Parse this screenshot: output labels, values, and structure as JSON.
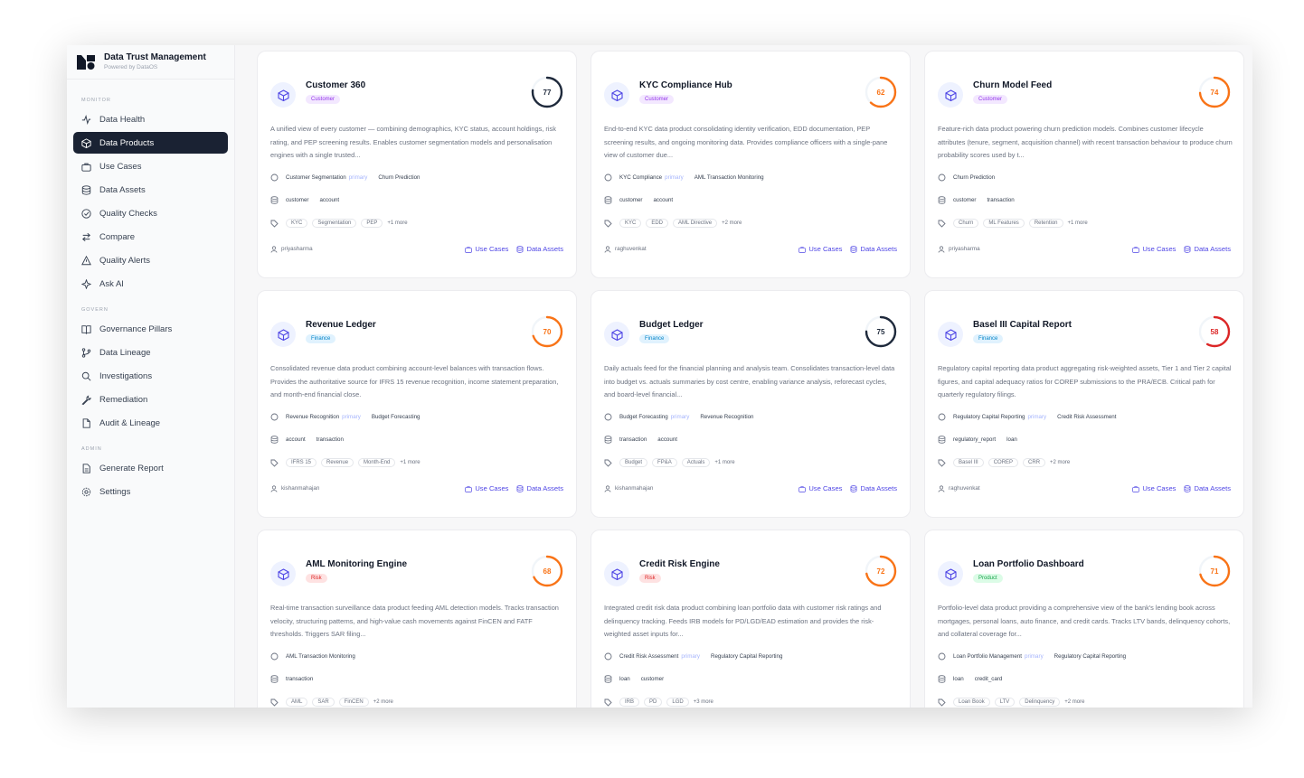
{
  "app": {
    "title": "Data Trust Management",
    "subtitle": "Powered by DataOS"
  },
  "nav": {
    "sections": [
      {
        "label": "MONITOR",
        "items": [
          {
            "label": "Data Health",
            "icon": "activity-icon",
            "active": false
          },
          {
            "label": "Data Products",
            "icon": "cube-icon",
            "active": true
          },
          {
            "label": "Use Cases",
            "icon": "briefcase-icon",
            "active": false
          },
          {
            "label": "Data Assets",
            "icon": "database-icon",
            "active": false
          },
          {
            "label": "Quality Checks",
            "icon": "check-circle-icon",
            "active": false
          },
          {
            "label": "Compare",
            "icon": "compare-icon",
            "active": false
          },
          {
            "label": "Quality Alerts",
            "icon": "alert-icon",
            "active": false
          },
          {
            "label": "Ask AI",
            "icon": "sparkle-icon",
            "active": false
          }
        ]
      },
      {
        "label": "GOVERN",
        "items": [
          {
            "label": "Governance Pillars",
            "icon": "book-icon",
            "active": false
          },
          {
            "label": "Data Lineage",
            "icon": "lineage-icon",
            "active": false
          },
          {
            "label": "Investigations",
            "icon": "search-icon",
            "active": false
          },
          {
            "label": "Remediation",
            "icon": "wrench-icon",
            "active": false
          },
          {
            "label": "Audit & Lineage",
            "icon": "file-icon",
            "active": false
          }
        ]
      },
      {
        "label": "ADMIN",
        "items": [
          {
            "label": "Generate Report",
            "icon": "report-icon",
            "active": false
          },
          {
            "label": "Settings",
            "icon": "gear-icon",
            "active": false
          }
        ]
      }
    ]
  },
  "colors": {
    "accent": "#4f46e5",
    "active_nav_bg": "#1a2233"
  },
  "cards": [
    {
      "title": "Customer 360",
      "badge": "Customer",
      "badge_type": "customer",
      "score": 77,
      "score_color": "#1e293b",
      "description": "A unified view of every customer — combining demographics, KYC status, account holdings, risk rating, and PEP screening results. Enables customer segmentation models and personalisation engines with a single trusted...",
      "use_cases": [
        "Customer Segmentation",
        "Churn Prediction"
      ],
      "primary_label": "primary",
      "assets": [
        "customer",
        "account"
      ],
      "tags": [
        "KYC",
        "Segmentation",
        "PEP"
      ],
      "more": "+1 more",
      "owner": "priyasharma",
      "link_use_cases": "Use Cases",
      "link_data_assets": "Data Assets"
    },
    {
      "title": "KYC Compliance Hub",
      "badge": "Customer",
      "badge_type": "customer",
      "score": 62,
      "score_color": "#f97316",
      "description": "End-to-end KYC data product consolidating identity verification, EDD documentation, PEP screening results, and ongoing monitoring data. Provides compliance officers with a single-pane view of customer due...",
      "use_cases": [
        "KYC Compliance",
        "AML Transaction Monitoring"
      ],
      "primary_label": "primary",
      "assets": [
        "customer",
        "account"
      ],
      "tags": [
        "KYC",
        "EDD",
        "AML Directive"
      ],
      "more": "+2 more",
      "owner": "raghuvenkat",
      "link_use_cases": "Use Cases",
      "link_data_assets": "Data Assets"
    },
    {
      "title": "Churn Model Feed",
      "badge": "Customer",
      "badge_type": "customer",
      "score": 74,
      "score_color": "#f97316",
      "description": "Feature-rich data product powering churn prediction models. Combines customer lifecycle attributes (tenure, segment, acquisition channel) with recent transaction behaviour to produce churn probability scores used by t...",
      "use_cases": [
        "Churn Prediction"
      ],
      "primary_label": "",
      "assets": [
        "customer",
        "transaction"
      ],
      "tags": [
        "Churn",
        "ML Features",
        "Retention"
      ],
      "more": "+1 more",
      "owner": "priyasharma",
      "link_use_cases": "Use Cases",
      "link_data_assets": "Data Assets"
    },
    {
      "title": "Revenue Ledger",
      "badge": "Finance",
      "badge_type": "finance",
      "score": 70,
      "score_color": "#f97316",
      "description": "Consolidated revenue data product combining account-level balances with transaction flows. Provides the authoritative source for IFRS 15 revenue recognition, income statement preparation, and month-end financial close.",
      "use_cases": [
        "Revenue Recognition",
        "Budget Forecasting"
      ],
      "primary_label": "primary",
      "assets": [
        "account",
        "transaction"
      ],
      "tags": [
        "IFRS 15",
        "Revenue",
        "Month-End"
      ],
      "more": "+1 more",
      "owner": "kishanmahajan",
      "link_use_cases": "Use Cases",
      "link_data_assets": "Data Assets"
    },
    {
      "title": "Budget Ledger",
      "badge": "Finance",
      "badge_type": "finance",
      "score": 75,
      "score_color": "#1e293b",
      "description": "Daily actuals feed for the financial planning and analysis team. Consolidates transaction-level data into budget vs. actuals summaries by cost centre, enabling variance analysis, reforecast cycles, and board-level financial...",
      "use_cases": [
        "Budget Forecasting",
        "Revenue Recognition"
      ],
      "primary_label": "primary",
      "assets": [
        "transaction",
        "account"
      ],
      "tags": [
        "Budget",
        "FP&A",
        "Actuals"
      ],
      "more": "+1 more",
      "owner": "kishanmahajan",
      "link_use_cases": "Use Cases",
      "link_data_assets": "Data Assets"
    },
    {
      "title": "Basel III Capital Report",
      "badge": "Finance",
      "badge_type": "finance",
      "score": 58,
      "score_color": "#dc2626",
      "description": "Regulatory capital reporting data product aggregating risk-weighted assets, Tier 1 and Tier 2 capital figures, and capital adequacy ratios for COREP submissions to the PRA/ECB. Critical path for quarterly regulatory filings.",
      "use_cases": [
        "Regulatory Capital Reporting",
        "Credit Risk Assessment"
      ],
      "primary_label": "primary",
      "assets": [
        "regulatory_report",
        "loan"
      ],
      "tags": [
        "Basel III",
        "COREP",
        "CRR"
      ],
      "more": "+2 more",
      "owner": "raghuvenkat",
      "link_use_cases": "Use Cases",
      "link_data_assets": "Data Assets"
    },
    {
      "title": "AML Monitoring Engine",
      "badge": "Risk",
      "badge_type": "risk",
      "score": 68,
      "score_color": "#f97316",
      "description": "Real-time transaction surveillance data product feeding AML detection models. Tracks transaction velocity, structuring patterns, and high-value cash movements against FinCEN and FATF thresholds. Triggers SAR filing...",
      "use_cases": [
        "AML Transaction Monitoring"
      ],
      "primary_label": "",
      "assets": [
        "transaction"
      ],
      "tags": [
        "AML",
        "SAR",
        "FinCEN"
      ],
      "more": "+2 more",
      "owner": "",
      "link_use_cases": "",
      "link_data_assets": ""
    },
    {
      "title": "Credit Risk Engine",
      "badge": "Risk",
      "badge_type": "risk",
      "score": 72,
      "score_color": "#f97316",
      "description": "Integrated credit risk data product combining loan portfolio data with customer risk ratings and delinquency tracking. Feeds IRB models for PD/LGD/EAD estimation and provides the risk-weighted asset inputs for...",
      "use_cases": [
        "Credit Risk Assessment",
        "Regulatory Capital Reporting"
      ],
      "primary_label": "primary",
      "assets": [
        "loan",
        "customer"
      ],
      "tags": [
        "IRB",
        "PD",
        "LGD"
      ],
      "more": "+3 more",
      "owner": "",
      "link_use_cases": "",
      "link_data_assets": ""
    },
    {
      "title": "Loan Portfolio Dashboard",
      "badge": "Product",
      "badge_type": "product",
      "score": 71,
      "score_color": "#f97316",
      "description": "Portfolio-level data product providing a comprehensive view of the bank's lending book across mortgages, personal loans, auto finance, and credit cards. Tracks LTV bands, delinquency cohorts, and collateral coverage for...",
      "use_cases": [
        "Loan Portfolio Management",
        "Regulatory Capital Reporting"
      ],
      "primary_label": "primary",
      "assets": [
        "loan",
        "credit_card"
      ],
      "tags": [
        "Loan Book",
        "LTV",
        "Delinquency"
      ],
      "more": "+2 more",
      "owner": "",
      "link_use_cases": "",
      "link_data_assets": ""
    }
  ]
}
